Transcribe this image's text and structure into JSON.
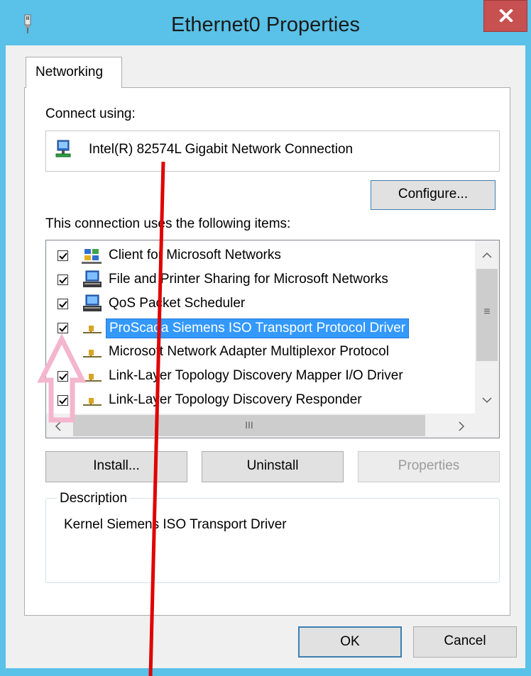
{
  "window": {
    "title": "Ethernet0 Properties",
    "close_label": "x"
  },
  "tabs": [
    {
      "label": "Networking",
      "selected": true
    }
  ],
  "connect_using": {
    "label": "Connect using:",
    "adapter_name": "Intel(R) 82574L Gigabit Network Connection",
    "configure_button": "Configure..."
  },
  "items_section": {
    "label": "This connection uses the following items:",
    "items": [
      {
        "label": "Client for Microsoft Networks",
        "checked": true,
        "icon": "network-client-icon",
        "selected": false
      },
      {
        "label": "File and Printer Sharing for Microsoft Networks",
        "checked": true,
        "icon": "computer-service-icon",
        "selected": false
      },
      {
        "label": "QoS Packet Scheduler",
        "checked": true,
        "icon": "computer-service-icon",
        "selected": false
      },
      {
        "label": "ProScada Siemens ISO Transport Protocol Driver",
        "checked": true,
        "icon": "protocol-icon",
        "selected": true
      },
      {
        "label": "Microsoft Network Adapter Multiplexor Protocol",
        "checked": false,
        "icon": "protocol-icon",
        "selected": false
      },
      {
        "label": "Link-Layer Topology Discovery Mapper I/O Driver",
        "checked": true,
        "icon": "protocol-icon",
        "selected": false
      },
      {
        "label": "Link-Layer Topology Discovery Responder",
        "checked": true,
        "icon": "protocol-icon",
        "selected": false
      }
    ],
    "scroll_grip": "≡",
    "hscroll_grip": "III"
  },
  "buttons": {
    "install": "Install...",
    "uninstall": "Uninstall",
    "properties": "Properties",
    "ok": "OK",
    "cancel": "Cancel"
  },
  "description": {
    "label": "Description",
    "text": "Kernel Siemens ISO Transport Driver"
  },
  "colors": {
    "titlebar": "#5ac1e8",
    "close": "#c75050",
    "selection": "#3399ff",
    "annotation_line": "#e00000",
    "annotation_arrow": "#f4b6cc"
  }
}
